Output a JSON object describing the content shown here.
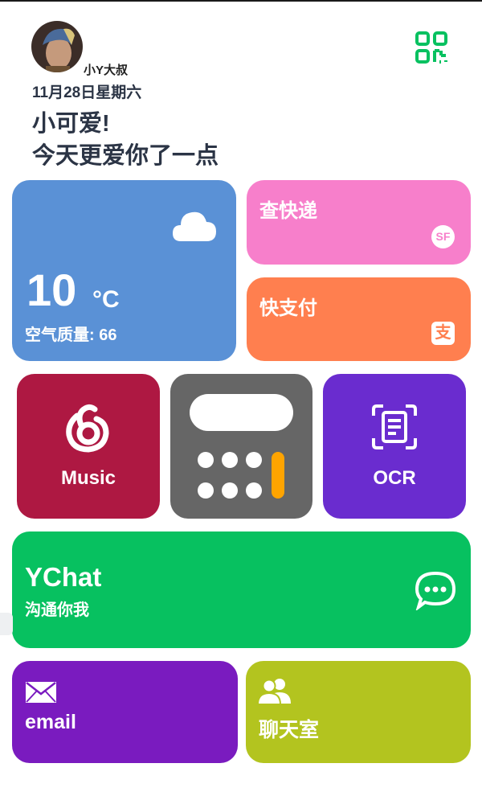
{
  "profile": {
    "username": "小Y大叔",
    "date": "11月28日星期六",
    "greeting_line1": "小可爱!",
    "greeting_line2": "今天更爱你了一点"
  },
  "icons": {
    "qr": "qr-code-icon",
    "weather": "cloud-icon",
    "express": "sf-express-icon",
    "pay": "alipay-icon",
    "music": "netease-music-icon",
    "calculator": "calculator-icon",
    "ocr": "document-scan-icon",
    "ychat": "chat-bubble-icon",
    "email": "envelope-icon",
    "chatroom": "users-icon"
  },
  "weather": {
    "temperature": "10",
    "unit": "°C",
    "air_quality": "空气质量: 66"
  },
  "tiles": {
    "express_label": "查快递",
    "express_badge": "SF",
    "pay_label": "快支付",
    "pay_badge": "支",
    "music_label": "Music",
    "ocr_label": "OCR",
    "ychat_title": "YChat",
    "ychat_subtitle": "沟通你我",
    "email_label": "email",
    "chatroom_label": "聊天室"
  },
  "colors": {
    "weather": "#5a91d6",
    "express": "#f77fcb",
    "pay": "#ff7f4f",
    "music": "#ae1842",
    "calculator": "#666666",
    "ocr": "#6a2ccf",
    "ychat": "#07c160",
    "email": "#7a1bbf",
    "chatroom": "#b3c41f",
    "calculator_accent": "#ffa400"
  }
}
